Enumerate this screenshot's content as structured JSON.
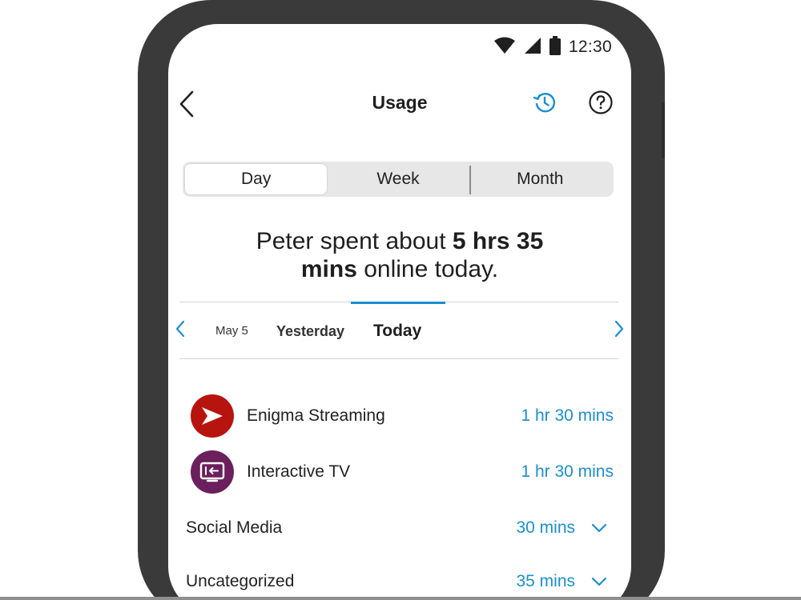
{
  "status_bar": {
    "time": "12:30",
    "icons": [
      "wifi-icon",
      "cell-signal-icon",
      "battery-icon"
    ]
  },
  "header": {
    "title": "Usage",
    "icons": [
      "back-chevron-icon",
      "history-icon",
      "help-icon"
    ]
  },
  "period_tabs": [
    {
      "label": "Day",
      "selected": true
    },
    {
      "label": "Week",
      "selected": false
    },
    {
      "label": "Month",
      "selected": false
    }
  ],
  "summary": {
    "prefix": "Peter spent about ",
    "duration_line1": "5 hrs 35",
    "duration_line2": "mins",
    "suffix": " online today."
  },
  "date_nav": {
    "items": [
      "May 5",
      "Yesterday",
      "Today"
    ],
    "selected": "Today"
  },
  "apps": [
    {
      "name": "Enigma Streaming",
      "time": "1 hr 30 mins",
      "icon": "send-arrow-icon",
      "color": "#b8140f"
    },
    {
      "name": "Interactive TV",
      "time": "1 hr 30 mins",
      "icon": "tv-input-icon",
      "color": "#6b1f5c"
    }
  ],
  "categories": [
    {
      "name": "Social Media",
      "time": "30 mins",
      "icon": "chevron-down-icon"
    },
    {
      "name": "Uncategorized",
      "time": "35 mins",
      "icon": "chevron-down-icon"
    }
  ],
  "colors": {
    "accent": "#1a8fd0",
    "frame": "#3a3a3a",
    "segment_bg": "#e7e7e7"
  }
}
